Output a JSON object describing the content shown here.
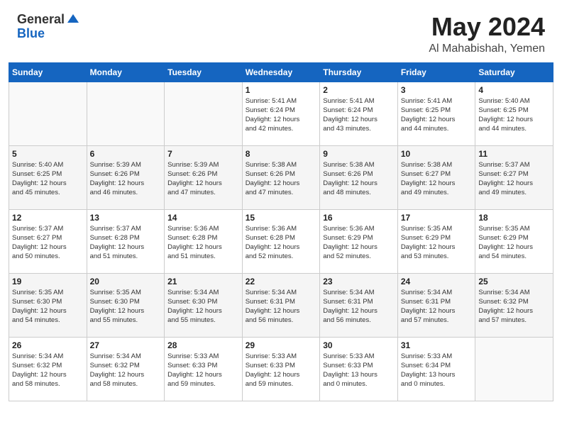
{
  "header": {
    "logo_general": "General",
    "logo_blue": "Blue",
    "month": "May 2024",
    "location": "Al Mahabishah, Yemen"
  },
  "days_of_week": [
    "Sunday",
    "Monday",
    "Tuesday",
    "Wednesday",
    "Thursday",
    "Friday",
    "Saturday"
  ],
  "weeks": [
    [
      {
        "day": "",
        "info": ""
      },
      {
        "day": "",
        "info": ""
      },
      {
        "day": "",
        "info": ""
      },
      {
        "day": "1",
        "info": "Sunrise: 5:41 AM\nSunset: 6:24 PM\nDaylight: 12 hours\nand 42 minutes."
      },
      {
        "day": "2",
        "info": "Sunrise: 5:41 AM\nSunset: 6:24 PM\nDaylight: 12 hours\nand 43 minutes."
      },
      {
        "day": "3",
        "info": "Sunrise: 5:41 AM\nSunset: 6:25 PM\nDaylight: 12 hours\nand 44 minutes."
      },
      {
        "day": "4",
        "info": "Sunrise: 5:40 AM\nSunset: 6:25 PM\nDaylight: 12 hours\nand 44 minutes."
      }
    ],
    [
      {
        "day": "5",
        "info": "Sunrise: 5:40 AM\nSunset: 6:25 PM\nDaylight: 12 hours\nand 45 minutes."
      },
      {
        "day": "6",
        "info": "Sunrise: 5:39 AM\nSunset: 6:26 PM\nDaylight: 12 hours\nand 46 minutes."
      },
      {
        "day": "7",
        "info": "Sunrise: 5:39 AM\nSunset: 6:26 PM\nDaylight: 12 hours\nand 47 minutes."
      },
      {
        "day": "8",
        "info": "Sunrise: 5:38 AM\nSunset: 6:26 PM\nDaylight: 12 hours\nand 47 minutes."
      },
      {
        "day": "9",
        "info": "Sunrise: 5:38 AM\nSunset: 6:26 PM\nDaylight: 12 hours\nand 48 minutes."
      },
      {
        "day": "10",
        "info": "Sunrise: 5:38 AM\nSunset: 6:27 PM\nDaylight: 12 hours\nand 49 minutes."
      },
      {
        "day": "11",
        "info": "Sunrise: 5:37 AM\nSunset: 6:27 PM\nDaylight: 12 hours\nand 49 minutes."
      }
    ],
    [
      {
        "day": "12",
        "info": "Sunrise: 5:37 AM\nSunset: 6:27 PM\nDaylight: 12 hours\nand 50 minutes."
      },
      {
        "day": "13",
        "info": "Sunrise: 5:37 AM\nSunset: 6:28 PM\nDaylight: 12 hours\nand 51 minutes."
      },
      {
        "day": "14",
        "info": "Sunrise: 5:36 AM\nSunset: 6:28 PM\nDaylight: 12 hours\nand 51 minutes."
      },
      {
        "day": "15",
        "info": "Sunrise: 5:36 AM\nSunset: 6:28 PM\nDaylight: 12 hours\nand 52 minutes."
      },
      {
        "day": "16",
        "info": "Sunrise: 5:36 AM\nSunset: 6:29 PM\nDaylight: 12 hours\nand 52 minutes."
      },
      {
        "day": "17",
        "info": "Sunrise: 5:35 AM\nSunset: 6:29 PM\nDaylight: 12 hours\nand 53 minutes."
      },
      {
        "day": "18",
        "info": "Sunrise: 5:35 AM\nSunset: 6:29 PM\nDaylight: 12 hours\nand 54 minutes."
      }
    ],
    [
      {
        "day": "19",
        "info": "Sunrise: 5:35 AM\nSunset: 6:30 PM\nDaylight: 12 hours\nand 54 minutes."
      },
      {
        "day": "20",
        "info": "Sunrise: 5:35 AM\nSunset: 6:30 PM\nDaylight: 12 hours\nand 55 minutes."
      },
      {
        "day": "21",
        "info": "Sunrise: 5:34 AM\nSunset: 6:30 PM\nDaylight: 12 hours\nand 55 minutes."
      },
      {
        "day": "22",
        "info": "Sunrise: 5:34 AM\nSunset: 6:31 PM\nDaylight: 12 hours\nand 56 minutes."
      },
      {
        "day": "23",
        "info": "Sunrise: 5:34 AM\nSunset: 6:31 PM\nDaylight: 12 hours\nand 56 minutes."
      },
      {
        "day": "24",
        "info": "Sunrise: 5:34 AM\nSunset: 6:31 PM\nDaylight: 12 hours\nand 57 minutes."
      },
      {
        "day": "25",
        "info": "Sunrise: 5:34 AM\nSunset: 6:32 PM\nDaylight: 12 hours\nand 57 minutes."
      }
    ],
    [
      {
        "day": "26",
        "info": "Sunrise: 5:34 AM\nSunset: 6:32 PM\nDaylight: 12 hours\nand 58 minutes."
      },
      {
        "day": "27",
        "info": "Sunrise: 5:34 AM\nSunset: 6:32 PM\nDaylight: 12 hours\nand 58 minutes."
      },
      {
        "day": "28",
        "info": "Sunrise: 5:33 AM\nSunset: 6:33 PM\nDaylight: 12 hours\nand 59 minutes."
      },
      {
        "day": "29",
        "info": "Sunrise: 5:33 AM\nSunset: 6:33 PM\nDaylight: 12 hours\nand 59 minutes."
      },
      {
        "day": "30",
        "info": "Sunrise: 5:33 AM\nSunset: 6:33 PM\nDaylight: 13 hours\nand 0 minutes."
      },
      {
        "day": "31",
        "info": "Sunrise: 5:33 AM\nSunset: 6:34 PM\nDaylight: 13 hours\nand 0 minutes."
      },
      {
        "day": "",
        "info": ""
      }
    ]
  ]
}
